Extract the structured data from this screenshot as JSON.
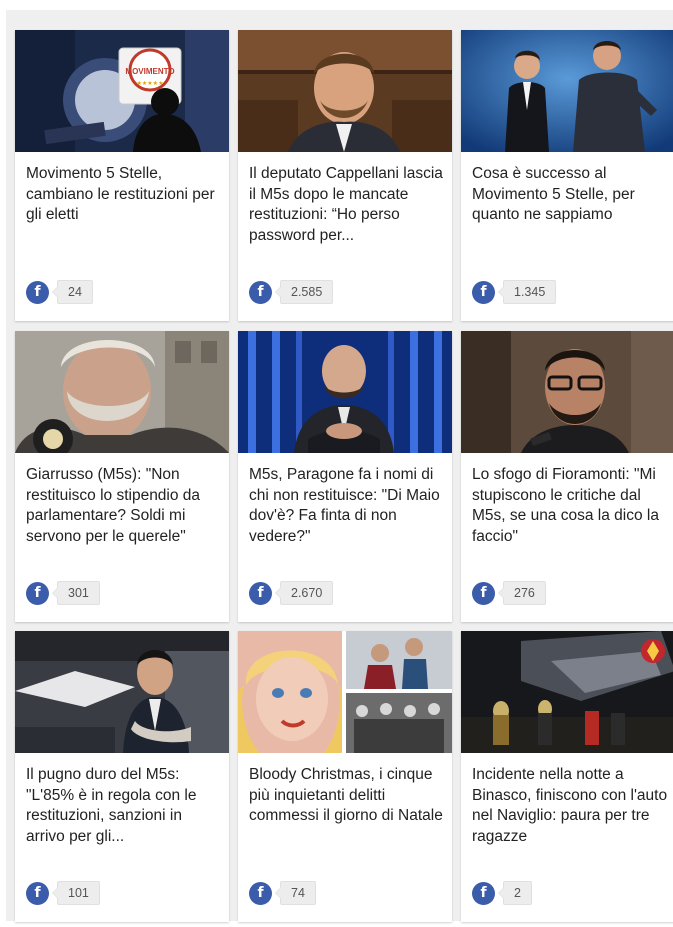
{
  "colors": {
    "facebook": "#3b5bab",
    "panel_bg": "#efefef",
    "text": "#222222"
  },
  "icons": {
    "share": "facebook-icon"
  },
  "facebook_glyph": "f",
  "cards": [
    {
      "title": "Movimento 5 Stelle, cambiano le restituzioni per gli eletti",
      "shares": "24",
      "thumb_logo_text": "MOVIMENTO"
    },
    {
      "title": "Il deputato Cappellani lascia il M5s dopo le mancate restituzioni: “Ho perso password per...",
      "shares": "2.585"
    },
    {
      "title": "Cosa è successo al Movimento 5 Stelle, per quanto ne sappiamo",
      "shares": "1.345"
    },
    {
      "title": "Giarrusso (M5s): \"Non restituisco lo stipendio da parlamentare? Soldi mi servono per le querele\"",
      "shares": "301"
    },
    {
      "title": "M5s, Paragone fa i nomi di chi non restituisce: \"Di Maio dov'è? Fa finta di non vedere?\"",
      "shares": "2.670"
    },
    {
      "title": "Lo sfogo di Fioramonti: \"Mi stupiscono le critiche dal M5s, se una cosa la dico la faccio\"",
      "shares": "276"
    },
    {
      "title": "Il pugno duro del M5s: \"L'85% è in regola con le restituzioni, sanzioni in arrivo per gli...",
      "shares": "101"
    },
    {
      "title": "Bloody Christmas, i cinque più inquietanti delitti commessi il giorno di Natale",
      "shares": "74"
    },
    {
      "title": "Incidente nella notte a Binasco, finiscono con l'auto nel Naviglio: paura per tre ragazze",
      "shares": "2"
    }
  ]
}
